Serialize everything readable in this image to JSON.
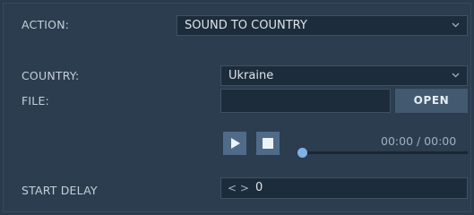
{
  "action": {
    "label": "ACTION:",
    "value": "SOUND TO COUNTRY"
  },
  "country": {
    "label": "COUNTRY:",
    "value": "Ukraine"
  },
  "file": {
    "label": "FILE:",
    "value": "",
    "open_label": "OPEN"
  },
  "player": {
    "time": "00:00 / 00:00",
    "progress": 0
  },
  "start_delay": {
    "label": "START DELAY",
    "arrows": "< >",
    "value": "0"
  },
  "colors": {
    "accent": "#7fb2e6",
    "button": "#4f6b88",
    "background": "#2c3d4f"
  }
}
